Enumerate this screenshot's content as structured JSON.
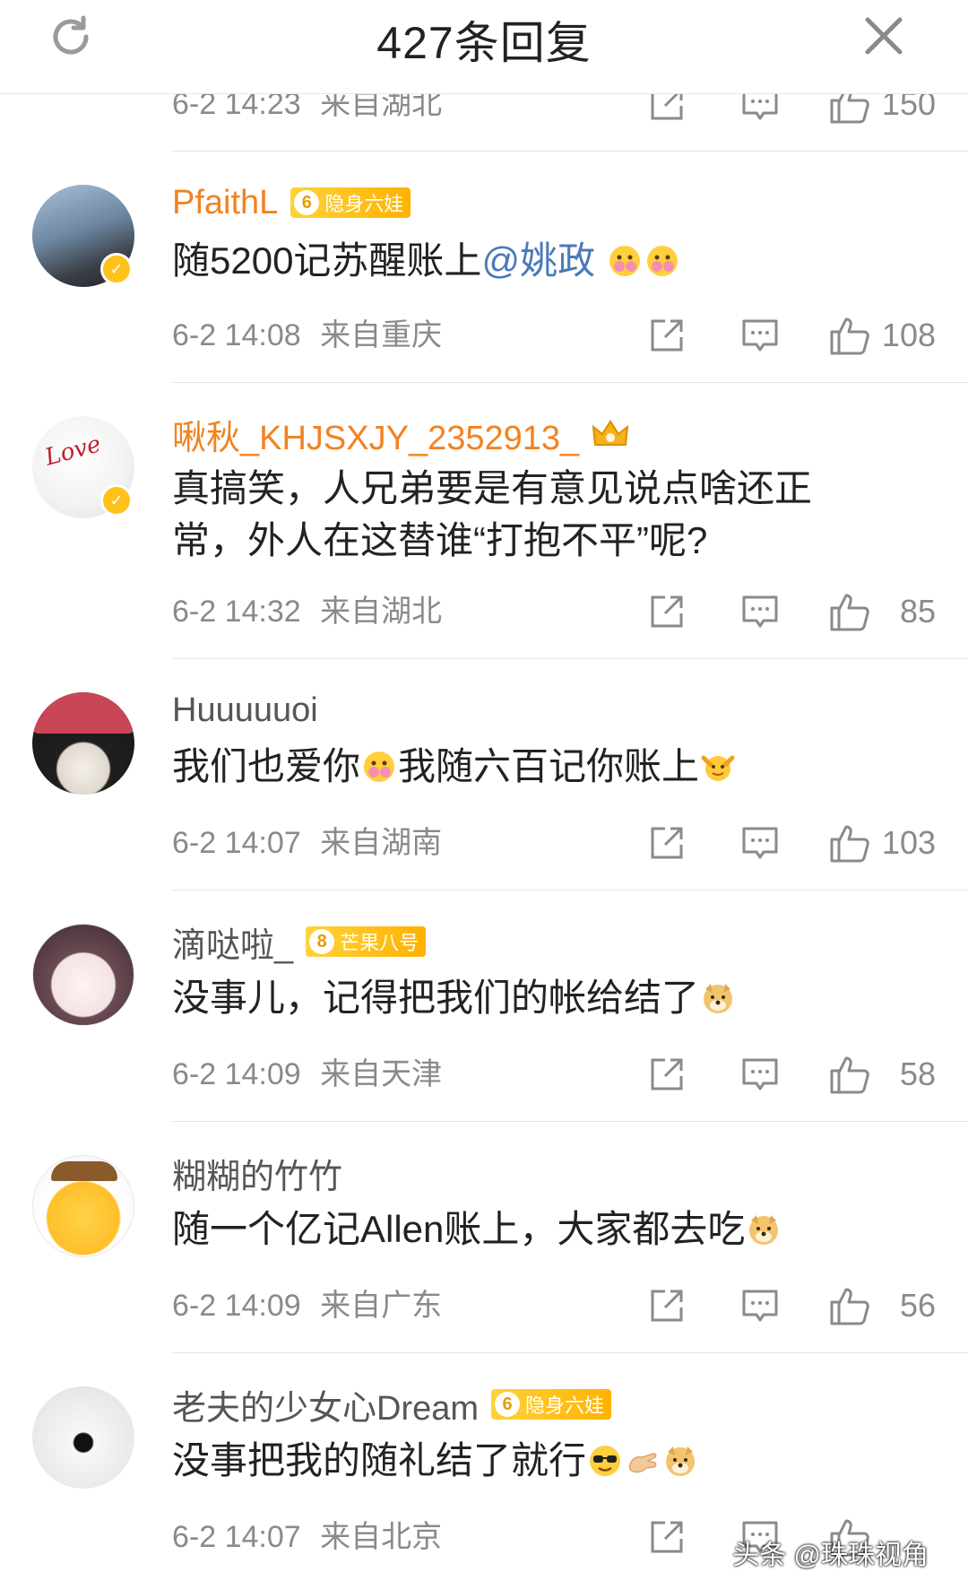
{
  "header": {
    "title": "427条回复"
  },
  "top_partial": {
    "time": "6-2 14:23",
    "location": "来自湖北",
    "likes": "150"
  },
  "comments": [
    {
      "username": "PfaithL",
      "vip": true,
      "badge_level": "6",
      "badge_text": "隐身六娃",
      "text_before": "随5200记苏醒账上",
      "mention": "@姚政",
      "text_after": "",
      "time": "6-2 14:08",
      "location": "来自重庆",
      "likes": "108"
    },
    {
      "username": "啾秋_KHJSXJY_2352913_",
      "vip": true,
      "text": "真搞笑，人兄弟要是有意见说点啥还正常，外人在这替谁“打抱不平”呢?",
      "time": "6-2 14:32",
      "location": "来自湖北",
      "likes": "85"
    },
    {
      "username": "Huuuuuoi",
      "text_a": "我们也爱你",
      "text_b": "我随六百记你账上",
      "time": "6-2 14:07",
      "location": "来自湖南",
      "likes": "103"
    },
    {
      "username": "滴哒啦_",
      "badge_level": "8",
      "badge_text": "芒果八号",
      "text": "没事儿，记得把我们的帐给结了",
      "time": "6-2 14:09",
      "location": "来自天津",
      "likes": "58"
    },
    {
      "username": "糊糊的竹竹",
      "text": "随一个亿记Allen账上，大家都去吃",
      "time": "6-2 14:09",
      "location": "来自广东",
      "likes": "56"
    },
    {
      "username": "老夫的少女心Dream",
      "badge_level": "6",
      "badge_text": "隐身六娃",
      "text": "没事把我的随礼结了就行",
      "time": "6-2 14:07",
      "location": "来自北京",
      "likes": ""
    }
  ],
  "watermark": "头条 @珠珠视角",
  "colors": {
    "accent_orange": "#f18322",
    "mention_blue": "#4a7ab8",
    "badge_gold": "#ffb200",
    "meta_gray": "#8a8a8a"
  }
}
